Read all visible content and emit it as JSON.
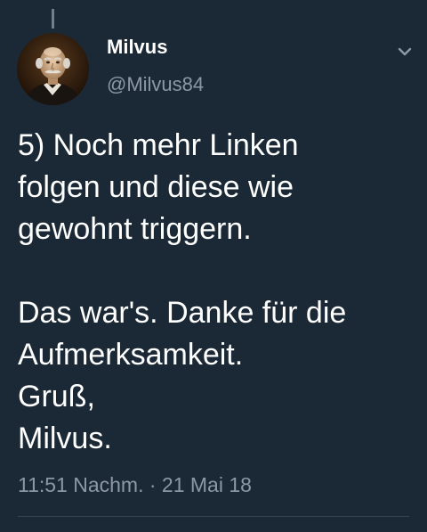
{
  "tweet": {
    "display_name": "Milvus",
    "handle": "@Milvus84",
    "text_lines": [
      "5) Noch mehr Linken",
      "folgen und diese wie",
      "gewohnt triggern.",
      "",
      "Das war's. Danke für die",
      "Aufmerksamkeit.",
      "Gruß,",
      "Milvus."
    ],
    "timestamp": "11:51 Nachm. · 21 Mai 18"
  },
  "icons": {
    "avatar": "portrait-avatar",
    "menu": "chevron-down-icon",
    "thread": "thread-connector"
  },
  "colors": {
    "background": "#1b2836",
    "primary_text": "#ffffff",
    "secondary_text": "#8b98a5",
    "divider": "#38444d"
  }
}
